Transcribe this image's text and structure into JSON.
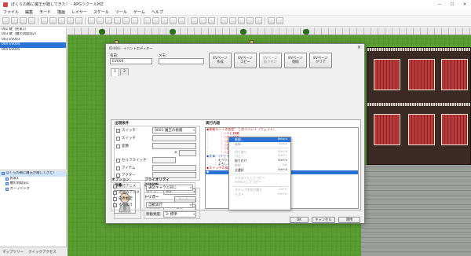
{
  "window": {
    "title": "ぼくらの鵜に魔王が踏してきた！ - RPGツクールMZ",
    "minimize": "—",
    "maximize": "☐",
    "close": "✕"
  },
  "menubar": [
    "ファイル",
    "編集",
    "モード",
    "描画",
    "レイヤー",
    "スケール",
    "ツール",
    "ゲーム",
    "ヘルプ"
  ],
  "event_list": [
    {
      "label": "002  鍵（民家1）",
      "selected": false
    },
    {
      "label": "003  鍵（魔の洞窟前2）",
      "selected": false
    },
    {
      "label": "003  EV003",
      "selected": false
    },
    {
      "label": "004  EV004",
      "selected": true
    },
    {
      "label": "005  EV005",
      "selected": false
    }
  ],
  "map_tree": [
    {
      "label": "ぼくらの鵜に魔王が踏してきた！",
      "selected": true,
      "indent": 0
    },
    {
      "label": "民家1",
      "selected": false,
      "indent": 1
    },
    {
      "label": "魔の洞窟前1",
      "selected": false,
      "indent": 1
    },
    {
      "label": "オープニング",
      "selected": false,
      "indent": 1
    }
  ],
  "left_tabs": [
    "マップツリー",
    "クイックアクセス"
  ],
  "dialog": {
    "title": "ID:004 - イベントエディター",
    "close": "✕",
    "name_label": "名前:",
    "name_value": "EV004",
    "note_label": "メモ:",
    "note_value": "",
    "page_buttons": [
      {
        "line1": "EVページ",
        "line2": "作成",
        "enabled": true
      },
      {
        "line1": "EVページ",
        "line2": "コピー",
        "enabled": true
      },
      {
        "line1": "EVページ",
        "line2": "貼り付け",
        "enabled": false
      },
      {
        "line1": "EVページ",
        "line2": "削除",
        "enabled": true
      },
      {
        "line1": "EVページ",
        "line2": "クリア",
        "enabled": true
      }
    ],
    "page_tabs": [
      "1",
      "2"
    ],
    "conditions": {
      "title": "出現条件",
      "switch1_label": "スイッチ",
      "switch1_checked": true,
      "switch1_value": "0001 魔王の挑戦",
      "switch2_label": "スイッチ",
      "switch2_checked": false,
      "switch2_value": "",
      "variable_label": "変数",
      "variable_checked": false,
      "variable_value": "",
      "ge": "≥",
      "self_switch_label": "セルフスイッチ",
      "self_switch_checked": false,
      "item_label": "アイテム",
      "item_checked": false,
      "actor_label": "アクター",
      "actor_checked": false
    },
    "image_label": "画像",
    "autonomous": {
      "title": "自律移動",
      "type_label": "タイプ:",
      "type_value": "固定",
      "route_button": "ルート...",
      "speed_label": "移動速度:",
      "speed_value": "3: 1/2倍速",
      "freq_label": "移動頻度:",
      "freq_value": "3: 標準"
    },
    "options": {
      "title": "オプション",
      "walking_label": "歩行アニメ",
      "walking_checked": true,
      "stepping_label": "足踏みアニメ",
      "stepping_checked": true,
      "direction_fix_label": "向き固定",
      "direction_fix_checked": false,
      "through_label": "すり抜け",
      "through_checked": true
    },
    "priority": {
      "title": "プライオリティ",
      "value": "通常キャラと同じ"
    },
    "trigger": {
      "title": "トリガー",
      "value": "自動実行"
    },
    "contents_title": "実行内容",
    "contents": [
      {
        "text": "◆移動ルートの設定：このイベント（ウェイト）",
        "color": "red",
        "selected": false
      },
      {
        "text": "：　　　　：◇下に移動",
        "color": "red",
        "selected": false
      },
      {
        "text": "：　　　　：◇左に移動",
        "color": "red",
        "selected": false
      },
      {
        "text": "：　　　　：◇右に移動",
        "color": "red",
        "selected": false
      },
      {
        "text": "：　　　　：◇左に移動",
        "color": "red",
        "selected": false
      },
      {
        "text": "：　　　　：◇右に移動",
        "color": "red",
        "selected": false
      },
      {
        "text": "：　　　　：◇上を向く",
        "color": "red",
        "selected": false
      },
      {
        "text": "◆文章：(ファイル)なし, People1(0), ウィンドウ, 下",
        "color": "blue",
        "selected": false
      },
      {
        "text": "：　　：えべりぃです。",
        "color": "black",
        "selected": false
      },
      {
        "text": "：　　：よろしく！",
        "color": "black",
        "selected": false
      },
      {
        "text": "◆スイッチの操作：#0001 魔王の挑戦 = OFF",
        "color": "red",
        "selected": false
      },
      {
        "text": "◆",
        "color": "black",
        "selected": true
      }
    ],
    "ok": "OK",
    "cancel": "キャンセル",
    "apply": "適用"
  },
  "context_menu": [
    {
      "label": "新規...",
      "shortcut": "Return",
      "state": "highlight"
    },
    {
      "label": "編集...",
      "shortcut": "Space",
      "state": "disabled"
    },
    {
      "sep": true
    },
    {
      "label": "切り取り",
      "shortcut": "Ctrl+X",
      "state": "disabled"
    },
    {
      "label": "コピー",
      "shortcut": "Ctrl+C",
      "state": "disabled"
    },
    {
      "label": "貼り付け",
      "shortcut": "Ctrl+V",
      "state": "normal"
    },
    {
      "label": "削除",
      "shortcut": "Del",
      "state": "disabled"
    },
    {
      "label": "全選択",
      "shortcut": "Ctrl+A",
      "state": "normal"
    },
    {
      "sep": true
    },
    {
      "label": "テキストとしてコピー",
      "shortcut": "",
      "state": "disabled"
    },
    {
      "label": "HTMLとしてコピー",
      "shortcut": "",
      "state": "disabled"
    },
    {
      "sep": true
    },
    {
      "label": "スキップの切り替え",
      "shortcut": "Ctrl+/",
      "state": "disabled"
    },
    {
      "label": "テスト",
      "shortcut": "Ctrl+R",
      "state": "disabled"
    }
  ]
}
